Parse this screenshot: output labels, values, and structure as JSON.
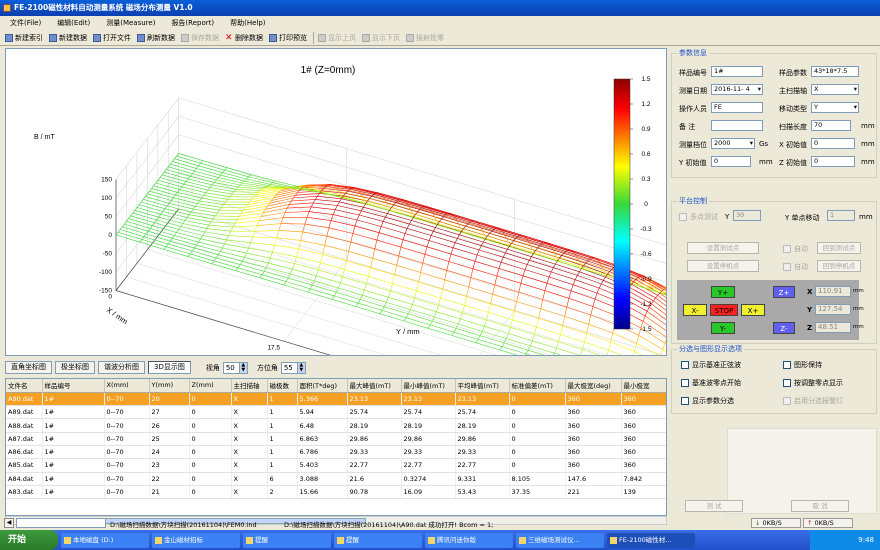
{
  "window": {
    "title": "FE-2100磁性材料自动测量系统 磁场分布测量 V1.0"
  },
  "menu": [
    "文件(File)",
    "编辑(Edit)",
    "测量(Measure)",
    "报告(Report)",
    "帮助(Help)"
  ],
  "toolbar": [
    {
      "label": "新建索引",
      "icon": "new-index-icon",
      "enabled": true
    },
    {
      "label": "新建数据",
      "icon": "new-data-icon",
      "enabled": true
    },
    {
      "label": "打开文件",
      "icon": "open-folder-icon",
      "enabled": true
    },
    {
      "label": "刷新数据",
      "icon": "refresh-icon",
      "enabled": true
    },
    {
      "label": "保存数据",
      "icon": "save-icon",
      "enabled": false
    },
    {
      "label": "删除数据",
      "icon": "delete-icon",
      "enabled": true
    },
    {
      "label": "打印预览",
      "icon": "print-preview-icon",
      "enabled": true
    },
    {
      "label": "显示上页",
      "icon": "prev-page-icon",
      "enabled": false
    },
    {
      "label": "显示下页",
      "icon": "next-page-icon",
      "enabled": false
    },
    {
      "label": "报射批零",
      "icon": "batch-icon",
      "enabled": false
    }
  ],
  "chart": {
    "title": "1# (Z=0mm)",
    "zlabel": "B / mT",
    "xlabel": "X / mm",
    "ylabel": "Y / mm",
    "zticks": [
      "150",
      "100",
      "50",
      "0",
      "-50",
      "-100",
      "-150"
    ],
    "xticks": [
      "0",
      "17.5",
      "35",
      "52.5",
      "70"
    ],
    "yticks": [
      "0",
      "5",
      "10",
      "15",
      "20",
      "25",
      "30"
    ],
    "colorbar_ticks": [
      "1.5",
      "1.2",
      "0.9",
      "0.6",
      "0.3",
      "0",
      "-0.3",
      "-0.6",
      "-0.9",
      "-1.2",
      "-1.5"
    ]
  },
  "chart_data": {
    "type": "surface",
    "title": "1# (Z=0mm)",
    "x_range": [
      0,
      70
    ],
    "y_range": [
      0,
      30
    ],
    "z_range": [
      -150,
      150
    ],
    "colorbar_range": [
      -1.5,
      1.5
    ],
    "surface": "flat-topped plateau near 150 mT over the magnet footprint, falling to about 0 at the edges"
  },
  "view_tabs": [
    "直角坐标图",
    "极坐标图",
    "谐波分析图",
    "3D显示图"
  ],
  "view": {
    "angle_label": "视角",
    "angle": "50",
    "azimuth_label": "方位角",
    "azimuth": "55"
  },
  "table": {
    "headers": [
      "文件名",
      "样品编号",
      "X(mm)",
      "Y(mm)",
      "Z(mm)",
      "主扫描轴",
      "磁极数",
      "面积(T*deg)",
      "最大峰值(mT)",
      "最小峰值(mT)",
      "平均峰值(mT)",
      "标准偏差(mT)",
      "最大极宽(deg)",
      "最小极宽"
    ],
    "rows": [
      [
        "A90.dat",
        "1#",
        "0--70",
        "20",
        "0",
        "X",
        "1",
        "5.366",
        "23.13",
        "23.13",
        "23.13",
        "0",
        "360",
        "360"
      ],
      [
        "A89.dat",
        "1#",
        "0--70",
        "27",
        "0",
        "X",
        "1",
        "5.94",
        "25.74",
        "25.74",
        "25.74",
        "0",
        "360",
        "360"
      ],
      [
        "A88.dat",
        "1#",
        "0--70",
        "26",
        "0",
        "X",
        "1",
        "6.48",
        "28.19",
        "28.19",
        "28.19",
        "0",
        "360",
        "360"
      ],
      [
        "A87.dat",
        "1#",
        "0--70",
        "25",
        "0",
        "X",
        "1",
        "6.863",
        "29.86",
        "29.86",
        "29.86",
        "0",
        "360",
        "360"
      ],
      [
        "A86.dat",
        "1#",
        "0--70",
        "24",
        "0",
        "X",
        "1",
        "6.786",
        "29.33",
        "29.33",
        "29.33",
        "0",
        "360",
        "360"
      ],
      [
        "A85.dat",
        "1#",
        "0--70",
        "23",
        "0",
        "X",
        "1",
        "5.403",
        "22.77",
        "22.77",
        "22.77",
        "0",
        "360",
        "360"
      ],
      [
        "A84.dat",
        "1#",
        "0--70",
        "22",
        "0",
        "X",
        "6",
        "3.088",
        "21.6",
        "0.3274",
        "9.331",
        "8.105",
        "147.6",
        "7.842"
      ],
      [
        "A83.dat",
        "1#",
        "0--70",
        "21",
        "0",
        "X",
        "2",
        "15.66",
        "90.78",
        "16.09",
        "53.43",
        "37.35",
        "221",
        "139"
      ]
    ]
  },
  "status": {
    "path": "D:\\磁场扫描数据\\方块扫描(20161104)\\FEM0.ind",
    "message": "D:\\磁场扫描数据\\方块扫描(20161104)\\A90.dat 成功打开! Bcom = 1;"
  },
  "params": {
    "legend": "参数信息",
    "sample_no_label": "样品编号",
    "sample_no": "1#",
    "sample_param_label": "样品参数",
    "sample_param": "43*18*7.5",
    "date_label": "测量日期",
    "date": "2016-11- 4",
    "main_axis_label": "主扫描轴",
    "main_axis": "X",
    "operator_label": "操作人员",
    "operator": "FE",
    "move_type_label": "移动类型",
    "move_type": "Y",
    "remark_label": "备    注",
    "remark": "",
    "scan_len_label": "扫描长度",
    "scan_len": "70",
    "scan_len_unit": "mm",
    "range_label": "测量档位",
    "range": "2000",
    "range_unit": "Gs",
    "x_init_label": "X 初始值",
    "x_init": "0",
    "x_init_unit": "mm",
    "y_init_label": "Y 初始值",
    "y_init": "0",
    "y_init_unit": "mm",
    "z_init_label": "Z 初始值",
    "z_init": "0",
    "z_init_unit": "mm"
  },
  "platform": {
    "legend": "平台控制",
    "multi_label": "多点测试",
    "multi_axis": "Y",
    "multi_val": "30",
    "single_label": "Y 单点移动",
    "single_val": "1",
    "single_unit": "mm",
    "set_test_point": "设置测试点",
    "set_stop_point": "设置停机点",
    "auto1": "自动",
    "auto2": "自动",
    "return_test": "回到测试点",
    "return_stop": "回到停机点",
    "y_plus": "Y+",
    "y_minus": "Y-",
    "x_minus": "X-",
    "x_plus": "X+",
    "stop": "STOP",
    "z_plus": "Z+",
    "z_minus": "Z-",
    "x_pos_label": "X",
    "x_pos": "110.91",
    "x_pos_unit": "mm",
    "y_pos_label": "Y",
    "y_pos": "127.54",
    "y_pos_unit": "mm",
    "z_pos_label": "Z",
    "z_pos": "48.51",
    "z_pos_unit": "mm"
  },
  "display": {
    "legend": "分选与图形显示选项",
    "opt1": "显示基准正弦波",
    "opt2": "图形保持",
    "opt3": "基准波零点开始",
    "opt4": "按调整零点显示",
    "opt5": "显示参数分选",
    "opt6": "启用分选报警灯"
  },
  "bottom_buttons": {
    "test": "测 试",
    "cancel": "取 消"
  },
  "speed": {
    "down": "0KB/S",
    "up": "0KB/S"
  },
  "taskbar": {
    "start": "开始",
    "tasks": [
      "本地磁盘 (D:)",
      "金山磁材招标",
      "提醒",
      "提醒",
      "腾讯问迷你版",
      "三维磁场测试仪...",
      "FE-2100磁性材..."
    ],
    "clock": "9:48"
  },
  "colors": {
    "title_blue": "#0b3fb0",
    "select_orange": "#f4a023",
    "legend_blue": "#1c50c8"
  }
}
